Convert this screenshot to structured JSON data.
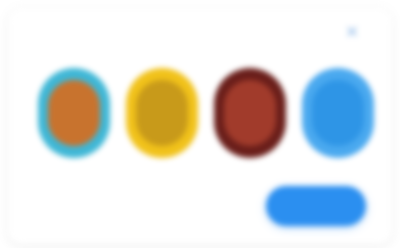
{
  "header": {
    "title": ""
  },
  "close": {
    "glyph": "×"
  },
  "thumbnails": [
    {
      "name": "avatar-1",
      "color": "#3fb7d6"
    },
    {
      "name": "avatar-2",
      "color": "#f1c21a"
    },
    {
      "name": "avatar-3",
      "color": "#6a1e1a"
    },
    {
      "name": "avatar-4",
      "color": "#4aa9ef"
    }
  ],
  "footer": {
    "subtitle": "",
    "action_label": ""
  },
  "colors": {
    "accent": "#2b8ff0"
  }
}
